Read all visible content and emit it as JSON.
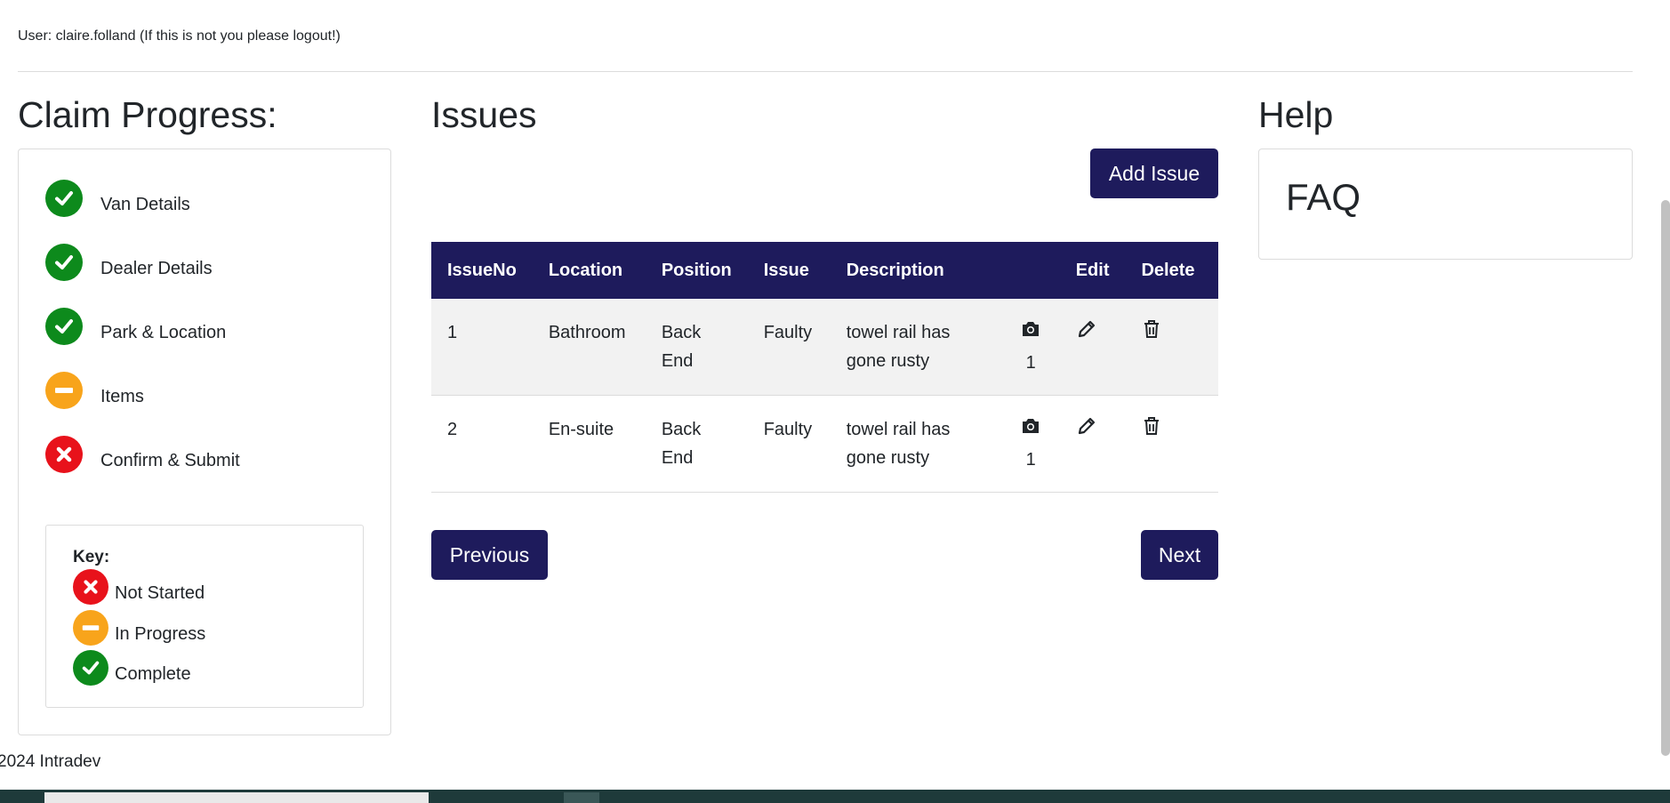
{
  "user_line": "User: claire.folland (If this is not you please logout!)",
  "progress": {
    "title": "Claim Progress:",
    "steps": [
      {
        "label": "Van Details",
        "status": "complete"
      },
      {
        "label": "Dealer Details",
        "status": "complete"
      },
      {
        "label": "Park & Location",
        "status": "complete"
      },
      {
        "label": "Items",
        "status": "in-progress"
      },
      {
        "label": "Confirm & Submit",
        "status": "not-started"
      }
    ],
    "key": {
      "title": "Key:",
      "not_started": "Not Started",
      "in_progress": "In Progress",
      "complete": "Complete"
    }
  },
  "issues": {
    "title": "Issues",
    "add_button": "Add Issue",
    "columns": [
      "IssueNo",
      "Location",
      "Position",
      "Issue",
      "Description",
      "",
      "Edit",
      "Delete"
    ],
    "rows": [
      {
        "no": "1",
        "location": "Bathroom",
        "position": "Back End",
        "issue": "Faulty",
        "description": "towel rail has gone rusty",
        "photos": "1"
      },
      {
        "no": "2",
        "location": "En-suite",
        "position": "Back End",
        "issue": "Faulty",
        "description": "towel rail has gone rusty",
        "photos": "1"
      }
    ],
    "previous_button": "Previous",
    "next_button": "Next"
  },
  "help": {
    "title": "Help",
    "faq": "FAQ"
  },
  "footer": "2024 Intradev",
  "colors": {
    "navy": "#1e1b5c",
    "complete": "#0d8a1c",
    "in_progress": "#f8a41b",
    "not_started": "#e8121b"
  }
}
